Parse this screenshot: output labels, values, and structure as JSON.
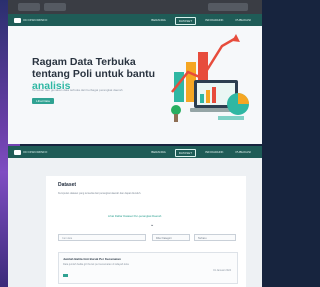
{
  "hero": {
    "logo_text": "OD DISKOMINFO",
    "nav": [
      "BERANDA",
      "DATASET",
      "INFOGRAFIK",
      "PUBLIKASI"
    ],
    "active_nav_index": 1,
    "title_line": "Ragam Data Terbuka tentang Poli untuk bantu ",
    "title_accent": "analisis",
    "subtitle": "Temukan dan gunakan data terbuka dari berbagai perangkat daerah",
    "button_label": "Lihat Data"
  },
  "dataset": {
    "logo_text": "OD DISKOMINFO",
    "nav": [
      "BERANDA",
      "DATASET",
      "INFOGRAFIK",
      "PUBLIKASI"
    ],
    "active_nav_index": 1,
    "title": "Dataset",
    "description": "Kumpulan dataset yang tersedia dari perangkat daerah dan dapat diunduh.",
    "link_text": "Lihat Daftar Dataset Per-perangkat Daerah",
    "icon": "chevron-down-icon",
    "search_placeholder": "Cari data",
    "filter_label": "Filter Kategori",
    "sort_label": "Terbaru",
    "result": {
      "title": "Jumlah Balita Gizi Buruk Per Kecamatan",
      "description": "Data jumlah balita gizi buruk per kecamatan di wilayah kota",
      "date": "01 Januari 2024"
    }
  },
  "colors": {
    "nav_bg": "#1f5c57",
    "accent": "#2fb7a3",
    "button": "#2fa292"
  }
}
